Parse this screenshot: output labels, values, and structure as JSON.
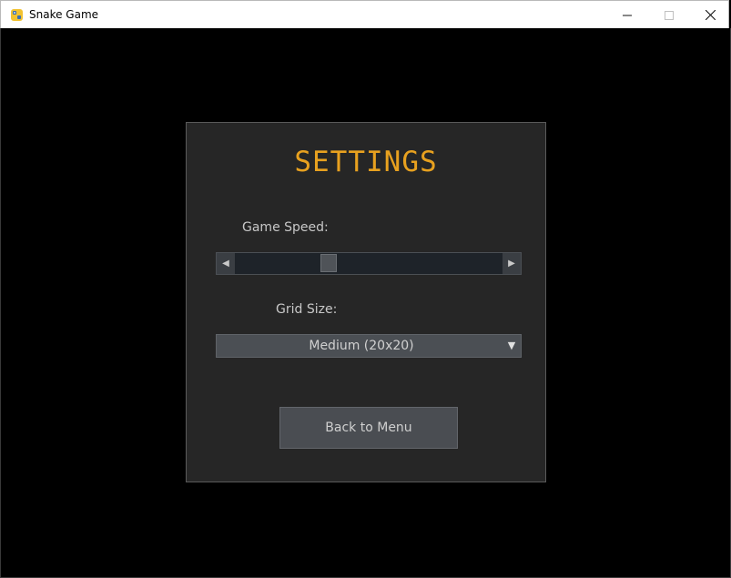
{
  "window": {
    "title": "Snake Game",
    "icon": "python-snake-icon",
    "controls": {
      "minimize": "—",
      "maximize": "☐",
      "close": "✕"
    }
  },
  "settings": {
    "heading": "SETTINGS",
    "heading_color": "#e8a11f",
    "game_speed": {
      "label": "Game Speed:",
      "value_fraction": 0.34,
      "left_arrow": "◀",
      "right_arrow": "▶"
    },
    "grid_size": {
      "label": "Grid Size:",
      "selected": "Medium (20x20)",
      "caret": "▼"
    },
    "back_button": "Back to Menu"
  }
}
